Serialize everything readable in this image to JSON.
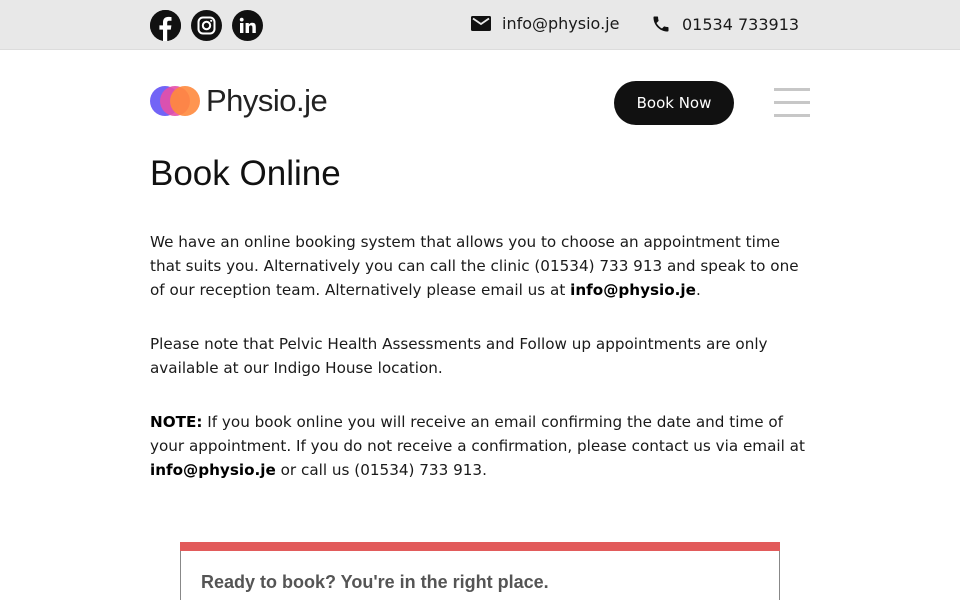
{
  "topbar": {
    "social": [
      {
        "name": "facebook",
        "icon": "facebook-icon"
      },
      {
        "name": "instagram",
        "icon": "instagram-icon"
      },
      {
        "name": "linkedin",
        "icon": "linkedin-icon",
        "glyph": "in"
      }
    ],
    "email": {
      "icon": "mail-icon",
      "text": "info@physio.je"
    },
    "phone": {
      "icon": "phone-icon",
      "text": "01534 733913"
    }
  },
  "header": {
    "logo_text": "Physio.je",
    "book_button": "Book Now",
    "menu_icon": "hamburger-menu-icon"
  },
  "main": {
    "title": "Book Online",
    "para1": {
      "text": "We have an online booking system that allows you to choose an appointment time that suits you. Alternatively you can call the clinic (01534) 733 913 and speak to one of our reception team. Alternatively please email us at ",
      "link": "info@physio.je",
      "end": "."
    },
    "para2": "Please note that Pelvic Health Assessments and Follow up appointments are only available at our Indigo House location.",
    "para3": {
      "label": "NOTE:",
      "text": " If you book online you will receive an email confirming the date and time of your appointment. If you do not receive a confirmation, please contact us via email at ",
      "link": "info@physio.je",
      "end": " or call us (01534) 733 913."
    }
  },
  "card": {
    "title": "Ready to book? You're in the right place.",
    "accent_color": "#e25b5b"
  },
  "colors": {
    "topbar_bg": "#e8e8e8",
    "button_bg": "#111111",
    "text": "#1a1a1a"
  }
}
